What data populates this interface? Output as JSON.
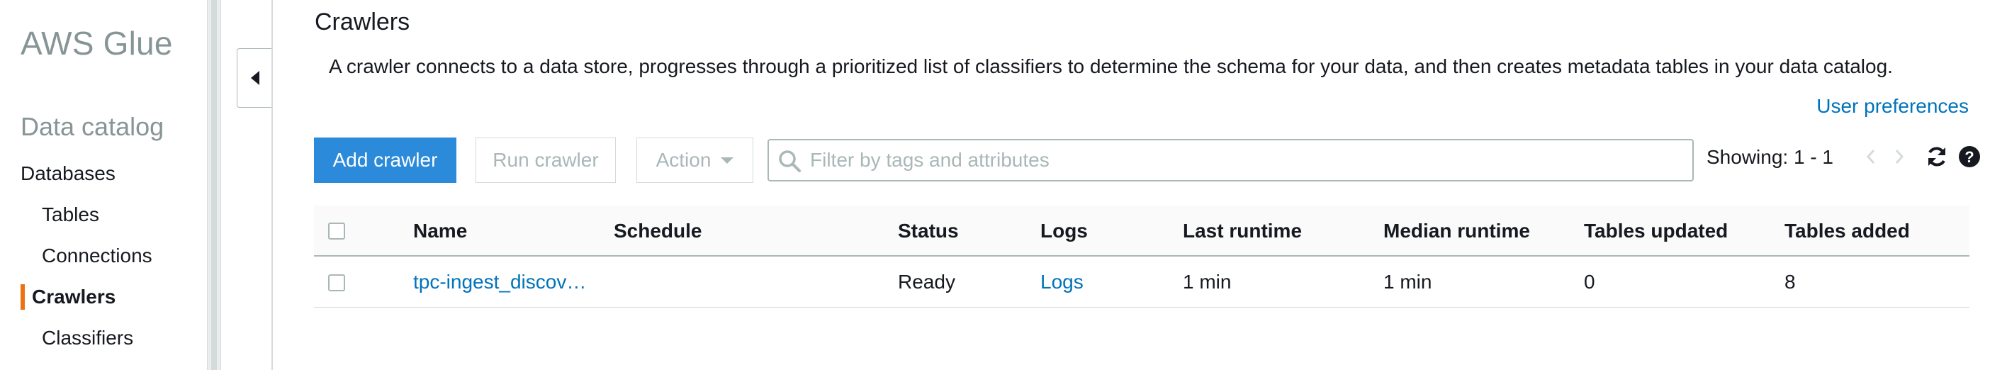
{
  "sidebar": {
    "app_title": "AWS Glue",
    "section_title": "Data catalog",
    "items": [
      {
        "label": "Databases"
      },
      {
        "label": "Tables"
      },
      {
        "label": "Connections"
      },
      {
        "label": "Crawlers"
      },
      {
        "label": "Classifiers"
      }
    ],
    "active_item": "Crawlers",
    "active_color": "#ec7211"
  },
  "main": {
    "title": "Crawlers",
    "description": "A crawler connects to a data store, progresses through a prioritized list of classifiers to determine the schema for your data, and then creates metadata tables in your data catalog.",
    "user_preferences_label": "User preferences",
    "toolbar": {
      "add_label": "Add crawler",
      "run_label": "Run crawler",
      "action_label": "Action",
      "search_placeholder": "Filter by tags and attributes",
      "showing_text": "Showing: 1 - 1"
    },
    "icons": {
      "collapse": "chevron-left-icon",
      "search": "search-icon",
      "refresh": "refresh-icon",
      "help": "help-icon",
      "prev": "chevron-left-icon",
      "next": "chevron-right-icon"
    },
    "table": {
      "columns": [
        "Name",
        "Schedule",
        "Status",
        "Logs",
        "Last runtime",
        "Median runtime",
        "Tables updated",
        "Tables added"
      ],
      "rows": [
        {
          "name": "tpc-ingest_discov…",
          "schedule": "",
          "status": "Ready",
          "logs": "Logs",
          "last_runtime": "1 min",
          "median_runtime": "1 min",
          "tables_updated": "0",
          "tables_added": "8"
        }
      ]
    },
    "colors": {
      "primary_button": "#2b8ad9",
      "link": "#0073bb"
    }
  }
}
